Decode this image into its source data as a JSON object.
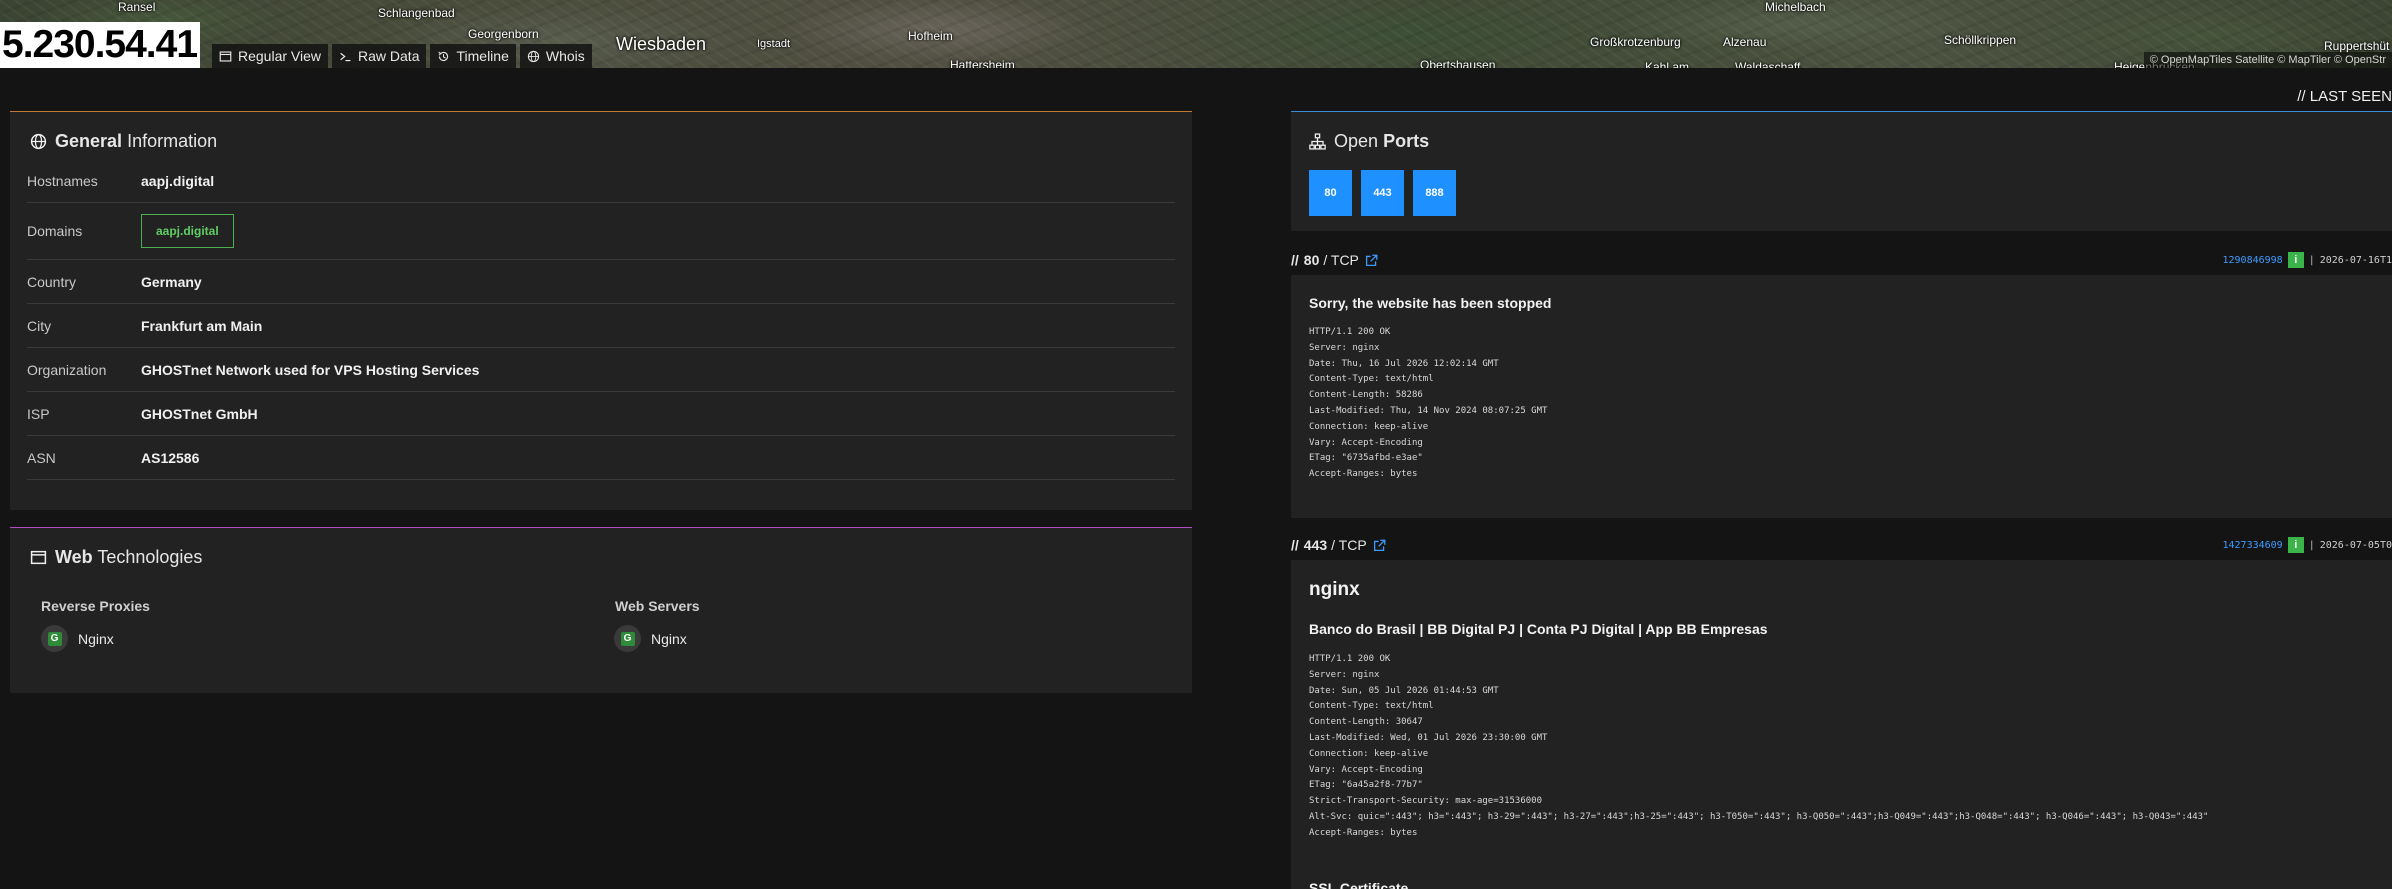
{
  "header": {
    "ip": "5.230.54.41",
    "tabs": [
      {
        "label": "Regular View",
        "icon": "window-icon"
      },
      {
        "label": "Raw Data",
        "icon": "terminal-icon"
      },
      {
        "label": "Timeline",
        "icon": "history-icon"
      },
      {
        "label": "Whois",
        "icon": "globe-icon"
      }
    ],
    "map": {
      "labels": [
        "Ransel",
        "Schlangenbad",
        "Georgenborn",
        "Igstadt",
        "Hofheim",
        "Hattersheim",
        "Obertshausen",
        "Großkrotzenburg",
        "Alzenau",
        "Michelbach",
        "Schöllkrippen",
        "Ruppertshüt",
        "Kahl am",
        "Waldaschaff",
        "Heigenbrücken"
      ],
      "city": "Wiesbaden",
      "attribution": "© OpenMapTiles Satellite  © MapTiler © OpenStr"
    }
  },
  "general": {
    "title_bold": "General",
    "title_rest": "Information",
    "rows": [
      {
        "key": "Hostnames",
        "value": "aapj.digital"
      },
      {
        "key": "Domains",
        "value": "aapj.digital"
      },
      {
        "key": "Country",
        "value": "Germany"
      },
      {
        "key": "City",
        "value": "Frankfurt am Main"
      },
      {
        "key": "Organization",
        "value": "GHOSTnet Network used for VPS Hosting Services"
      },
      {
        "key": "ISP",
        "value": "GHOSTnet GmbH"
      },
      {
        "key": "ASN",
        "value": "AS12586"
      }
    ]
  },
  "web": {
    "title_bold": "Web",
    "title_rest": "Technologies",
    "groups": [
      {
        "title": "Reverse Proxies",
        "item": "Nginx"
      },
      {
        "title": "Web Servers",
        "item": "Nginx"
      }
    ]
  },
  "last_seen": "// LAST SEEN",
  "ports": {
    "title_rest": "Open",
    "title_bold": "Ports",
    "list": [
      "80",
      "443",
      "888"
    ]
  },
  "services": [
    {
      "port": "80",
      "proto": "/ TCP",
      "hash": "1290846998",
      "timestamp": "2026-07-16T1",
      "title": "Sorry, the website has been stopped",
      "raw": "HTTP/1.1 200 OK\nServer: nginx\nDate: Thu, 16 Jul 2026 12:02:14 GMT\nContent-Type: text/html\nContent-Length: 58286\nLast-Modified: Thu, 14 Nov 2024 08:07:25 GMT\nConnection: keep-alive\nVary: Accept-Encoding\nETag: \"6735afbd-e3ae\"\nAccept-Ranges: bytes"
    },
    {
      "port": "443",
      "proto": "/ TCP",
      "hash": "1427334609",
      "timestamp": "2026-07-05T0",
      "product": "nginx",
      "title": "Banco do Brasil | BB Digital PJ | Conta PJ Digital | App BB Empresas",
      "raw": "HTTP/1.1 200 OK\nServer: nginx\nDate: Sun, 05 Jul 2026 01:44:53 GMT\nContent-Type: text/html\nContent-Length: 30647\nLast-Modified: Wed, 01 Jul 2026 23:30:00 GMT\nConnection: keep-alive\nVary: Accept-Encoding\nETag: \"6a45a2f8-77b7\"\nStrict-Transport-Security: max-age=31536000\nAlt-Svc: quic=\":443\"; h3=\":443\"; h3-29=\":443\"; h3-27=\":443\";h3-25=\":443\"; h3-T050=\":443\"; h3-Q050=\":443\";h3-Q049=\":443\";h3-Q048=\":443\"; h3-Q046=\":443\"; h3-Q043=\":443\"\nAccept-Ranges: bytes",
      "ssl_title": "SSL Certificate"
    }
  ],
  "colors": {
    "accent_blue": "#1e90ff",
    "accent_green": "#4caf50",
    "general_border": "#c27a30",
    "web_border": "#b04fc4",
    "ports_border": "#3a8edb"
  }
}
